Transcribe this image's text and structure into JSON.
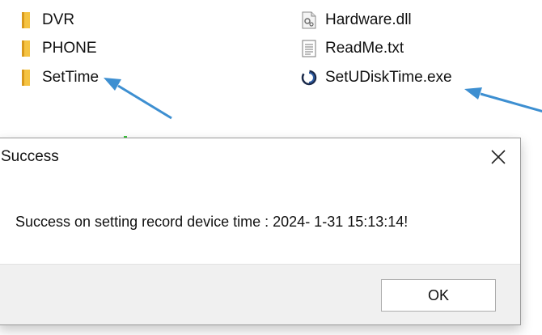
{
  "explorer": {
    "left_column": [
      {
        "name": "DVR",
        "icon": "folder-icon"
      },
      {
        "name": "PHONE",
        "icon": "folder-icon"
      },
      {
        "name": "SetTime",
        "icon": "folder-icon"
      }
    ],
    "right_column": [
      {
        "name": "Hardware.dll",
        "icon": "dll-file-icon"
      },
      {
        "name": "ReadMe.txt",
        "icon": "text-file-icon"
      },
      {
        "name": "SetUDiskTime.exe",
        "icon": "exe-app-icon"
      }
    ]
  },
  "dialog": {
    "title": "Success",
    "message": "Success on setting record device time : 2024- 1-31 15:13:14!",
    "ok_label": "OK"
  },
  "colors": {
    "folder": "#f5c342",
    "arrow": "#3d8fd1",
    "footer": "#f0f0f0"
  }
}
